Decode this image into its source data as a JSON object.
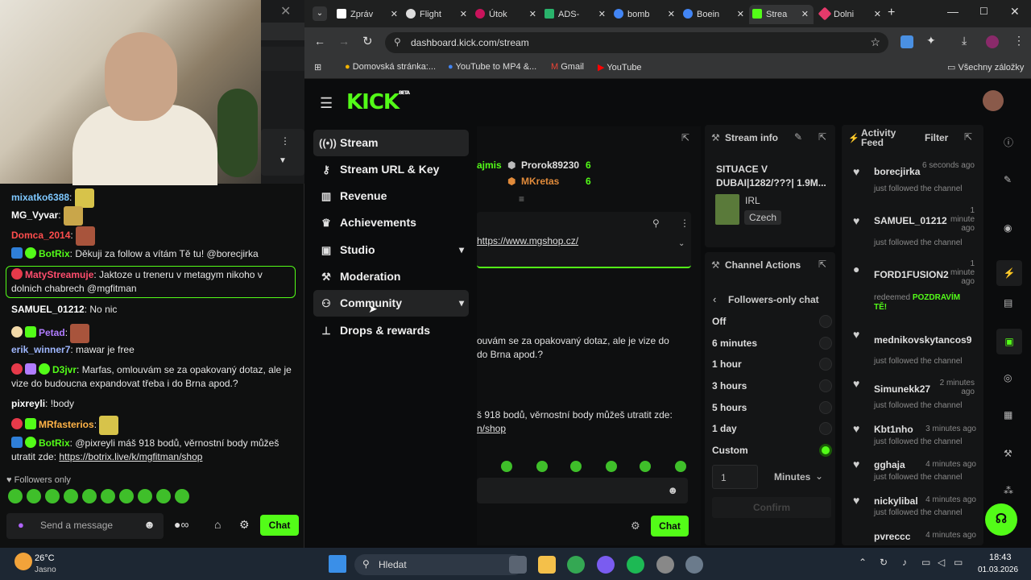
{
  "browser": {
    "tabs": [
      {
        "label": "Zpráv",
        "color": "#ffffff"
      },
      {
        "label": "Flight",
        "color": "#dddddd"
      },
      {
        "label": "Útok",
        "color": "#c8135b"
      },
      {
        "label": "ADS-",
        "color": "#29b36b"
      },
      {
        "label": "bomb",
        "color": "#4285f4"
      },
      {
        "label": "Boein",
        "color": "#4285f4"
      },
      {
        "label": "Strea",
        "color": "#53fc18"
      },
      {
        "label": "Dolni",
        "color": "#e63a6b"
      }
    ],
    "url": "dashboard.kick.com/stream",
    "bookmarks": [
      "Domovská stránka:...",
      "YouTube to MP4 &...",
      "Gmail",
      "YouTube"
    ],
    "all_bookmarks": "Všechny záložky"
  },
  "kick": {
    "logo": "KICK",
    "beta": "BETA",
    "menu": [
      {
        "label": "Stream",
        "icon": "stream-icon"
      },
      {
        "label": "Stream URL & Key",
        "icon": "key-icon"
      },
      {
        "label": "Revenue",
        "icon": "revenue-icon"
      },
      {
        "label": "Achievements",
        "icon": "trophy-icon"
      },
      {
        "label": "Studio",
        "icon": "studio-icon"
      },
      {
        "label": "Moderation",
        "icon": "wrench-icon"
      },
      {
        "label": "Community",
        "icon": "community-icon"
      },
      {
        "label": "Drops & rewards",
        "icon": "drops-icon"
      }
    ]
  },
  "center": {
    "user1": "ajmis",
    "user2": "Prorok89230",
    "count2": "6",
    "user3": "MKretas",
    "count3": "6",
    "pinned_link": "https://www.mgshop.cz/",
    "msg1a": "ouvám se za opakovaný dotaz, ale je vize do",
    "msg1b": "do Brna apod.?",
    "msg2a": "š 918 bodů, věrnostní body můžeš utratit zde:",
    "msg2b": "n/shop",
    "chat_btn": "Chat"
  },
  "stream_info": {
    "title": "Stream info",
    "stream_title": "SITUACE V DUBAI|1282/???| 1.9M...",
    "category": "IRL",
    "language": "Czech"
  },
  "channel_actions": {
    "title": "Channel Actions",
    "back_label": "Followers-only chat",
    "options": [
      "Off",
      "6 minutes",
      "1 hour",
      "3 hours",
      "5 hours",
      "1 day",
      "Custom"
    ],
    "selected": "Custom",
    "custom_value": "1",
    "unit": "Minutes",
    "confirm": "Confirm"
  },
  "activity": {
    "title_line1": "Activity",
    "title_line2": "Feed",
    "filter": "Filter",
    "items": [
      {
        "name": "borecjirka",
        "time": "6 seconds ago",
        "sub": "just followed the channel"
      },
      {
        "name": "SAMUEL_01212",
        "time": "1 minute ago",
        "sub": "just followed the channel"
      },
      {
        "name": "FORD1FUSION2",
        "time": "1 minute ago",
        "sub": "redeemed",
        "reward": "POZDRAVÍM TĚ!"
      },
      {
        "name": "mednikovskytancos9",
        "time": "",
        "sub": "just followed the channel"
      },
      {
        "name": "Simunekk27",
        "time": "2 minutes ago",
        "sub": "just followed the channel"
      },
      {
        "name": "Kbt1nho",
        "time": "3 minutes ago",
        "sub": "just followed the channel"
      },
      {
        "name": "gghaja",
        "time": "4 minutes ago",
        "sub": "just followed the channel"
      },
      {
        "name": "nickylibal",
        "time": "4 minutes ago",
        "sub": "just followed the channel"
      },
      {
        "name": "pvreccc",
        "time": "4 minutes ago",
        "sub": ""
      }
    ]
  },
  "chat": {
    "messages": [
      {
        "user": "mixatko6388",
        "color": "#7ec8ff",
        "text": ""
      },
      {
        "user": "MG_Vyvar",
        "color": "#ffffff",
        "text": ""
      },
      {
        "user": "Domca_2014",
        "color": "#ff4d4d",
        "text": ""
      },
      {
        "user": "BotRix",
        "color": "#53fc18",
        "text": "Děkuji za follow a vítám Tě tu! @borecjirka"
      },
      {
        "user": "MatyStreamuje",
        "color": "#ff4d6d",
        "text": "Jaktoze u treneru v metagym nikoho v dolnich chabrech @mgfitman"
      },
      {
        "user": "SAMUEL_01212",
        "color": "#ffffff",
        "text": "No nic"
      },
      {
        "user": "Petad",
        "color": "#b07cff",
        "text": ""
      },
      {
        "user": "erik_winner7",
        "color": "#9fb7ff",
        "text": "mawar je free"
      },
      {
        "user": "D3jvr",
        "color": "#53fc18",
        "text": "Marfas, omlouvám se za opakovaný dotaz, ale je vize do budoucna expandovat třeba i do Brna apod.?"
      },
      {
        "user": "pixreyli",
        "color": "#ffffff",
        "text": "!body"
      },
      {
        "user": "MRfasterios",
        "color": "#ffb347",
        "text": ""
      },
      {
        "user": "BotRix",
        "color": "#53fc18",
        "text": "@pixreyli máš 918 bodů, věrnostní body můžeš utratit zde:",
        "link": "https://botrix.live/k/mgfitman/shop"
      }
    ],
    "followers_only": "Followers only",
    "placeholder": "Send a message",
    "chat_btn": "Chat"
  },
  "taskbar": {
    "weather_temp": "26°C",
    "weather_desc": "Jasno",
    "search": "Hledat",
    "time": "18:43",
    "date": "01.03.2026"
  }
}
